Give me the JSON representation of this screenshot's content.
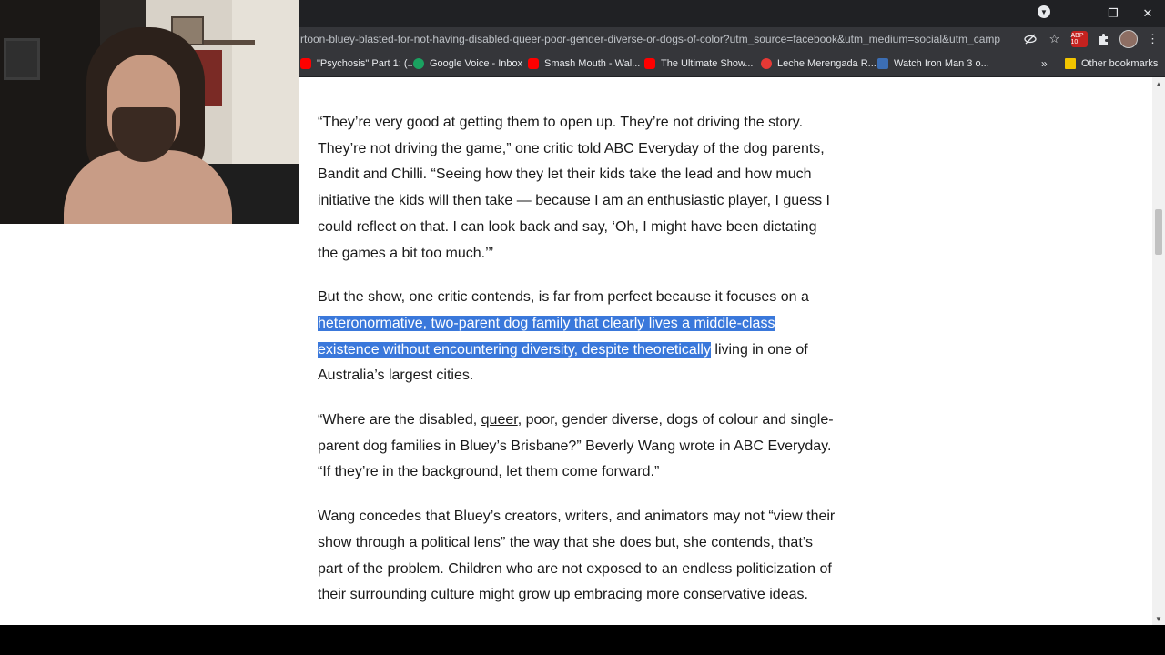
{
  "browser": {
    "url": "rtoon-bluey-blasted-for-not-having-disabled-queer-poor-gender-diverse-or-dogs-of-color?utm_source=facebook&utm_medium=social&utm_camp...",
    "window_controls": {
      "minimize": "–",
      "restore": "❐",
      "close": "✕"
    },
    "extension_badge": "ABP 10",
    "bookmarks": [
      {
        "label": "\"Psychosis\" Part 1: (...",
        "icon": "youtube-icon"
      },
      {
        "label": "Google Voice - Inbox",
        "icon": "google-voice-icon"
      },
      {
        "label": "Smash Mouth - Wal...",
        "icon": "youtube-icon"
      },
      {
        "label": "The Ultimate Show...",
        "icon": "youtube-icon"
      },
      {
        "label": "Leche Merengada R...",
        "icon": "lemon-icon"
      },
      {
        "label": "Watch Iron Man 3 o...",
        "icon": "globe-icon"
      }
    ],
    "bookmarks_more": "»",
    "other_bookmarks": "Other bookmarks"
  },
  "article": {
    "p1": "“They’re very good at getting them to open up. They’re not driving the story. They’re not driving the game,” one critic told ABC Everyday of the dog parents, Bandit and Chilli. “Seeing how they let their kids take the lead and how much initiative the kids will then take — because I am an enthusiastic player, I guess I could reflect on that. I can look back and say, ‘Oh, I might have been dictating the games a bit too much.’”",
    "p2_before": "But the show, one critic contends, is far from perfect because it focuses on a ",
    "p2_highlight": "heteronormative, two-parent dog family that clearly lives a middle-class existence without encountering diversity, despite theoretically",
    "p2_after": " living in one of Australia’s largest cities.",
    "p3_before": "“Where are the disabled, ",
    "p3_link": "queer",
    "p3_after": ", poor, gender diverse, dogs of colour and single-parent dog families in Bluey’s Brisbane?” Beverly Wang wrote in ABC Everyday. “If they’re in the background, let them come forward.”",
    "p4": "Wang concedes that Bluey’s creators, writers, and animators may not “view their show through a political lens” the way that she does but, she contends, that’s part of the problem. Children who are not exposed to an endless politicization of their surrounding culture might grow up embracing more conservative ideas."
  },
  "colors": {
    "chrome_dark": "#202124",
    "toolbar": "#35363a",
    "selection": "#3a78db"
  }
}
